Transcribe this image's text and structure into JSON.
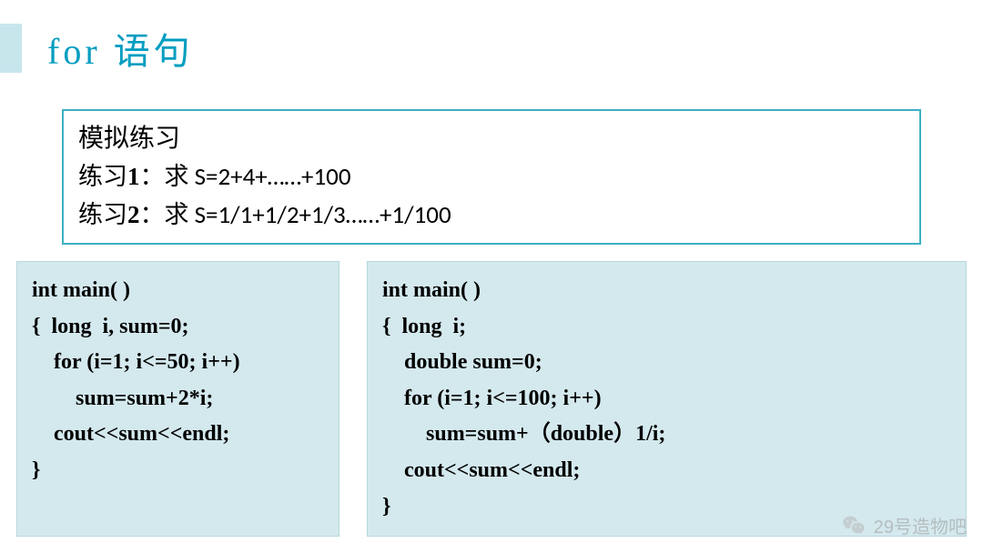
{
  "header": {
    "title": "for 语句"
  },
  "problems": {
    "heading": "模拟练习",
    "ex1_label": "练习",
    "ex1_num": "1",
    "ex1_tail": "：求 S=2+4+……+100",
    "ex2_label": "练习",
    "ex2_num": "2",
    "ex2_tail": "：求 S=1/1+1/2+1/3……+1/100"
  },
  "code": {
    "left": "int main( )\n{  long  i, sum=0;\n    for (i=1; i<=50; i++)\n        sum=sum+2*i;\n    cout<<sum<<endl;\n}",
    "right": "int main( )\n{  long  i;\n    double sum=0;\n    for (i=1; i<=100; i++)\n        sum=sum+（double）1/i;\n    cout<<sum<<endl;\n}"
  },
  "watermark": {
    "text": "29号造物吧"
  }
}
